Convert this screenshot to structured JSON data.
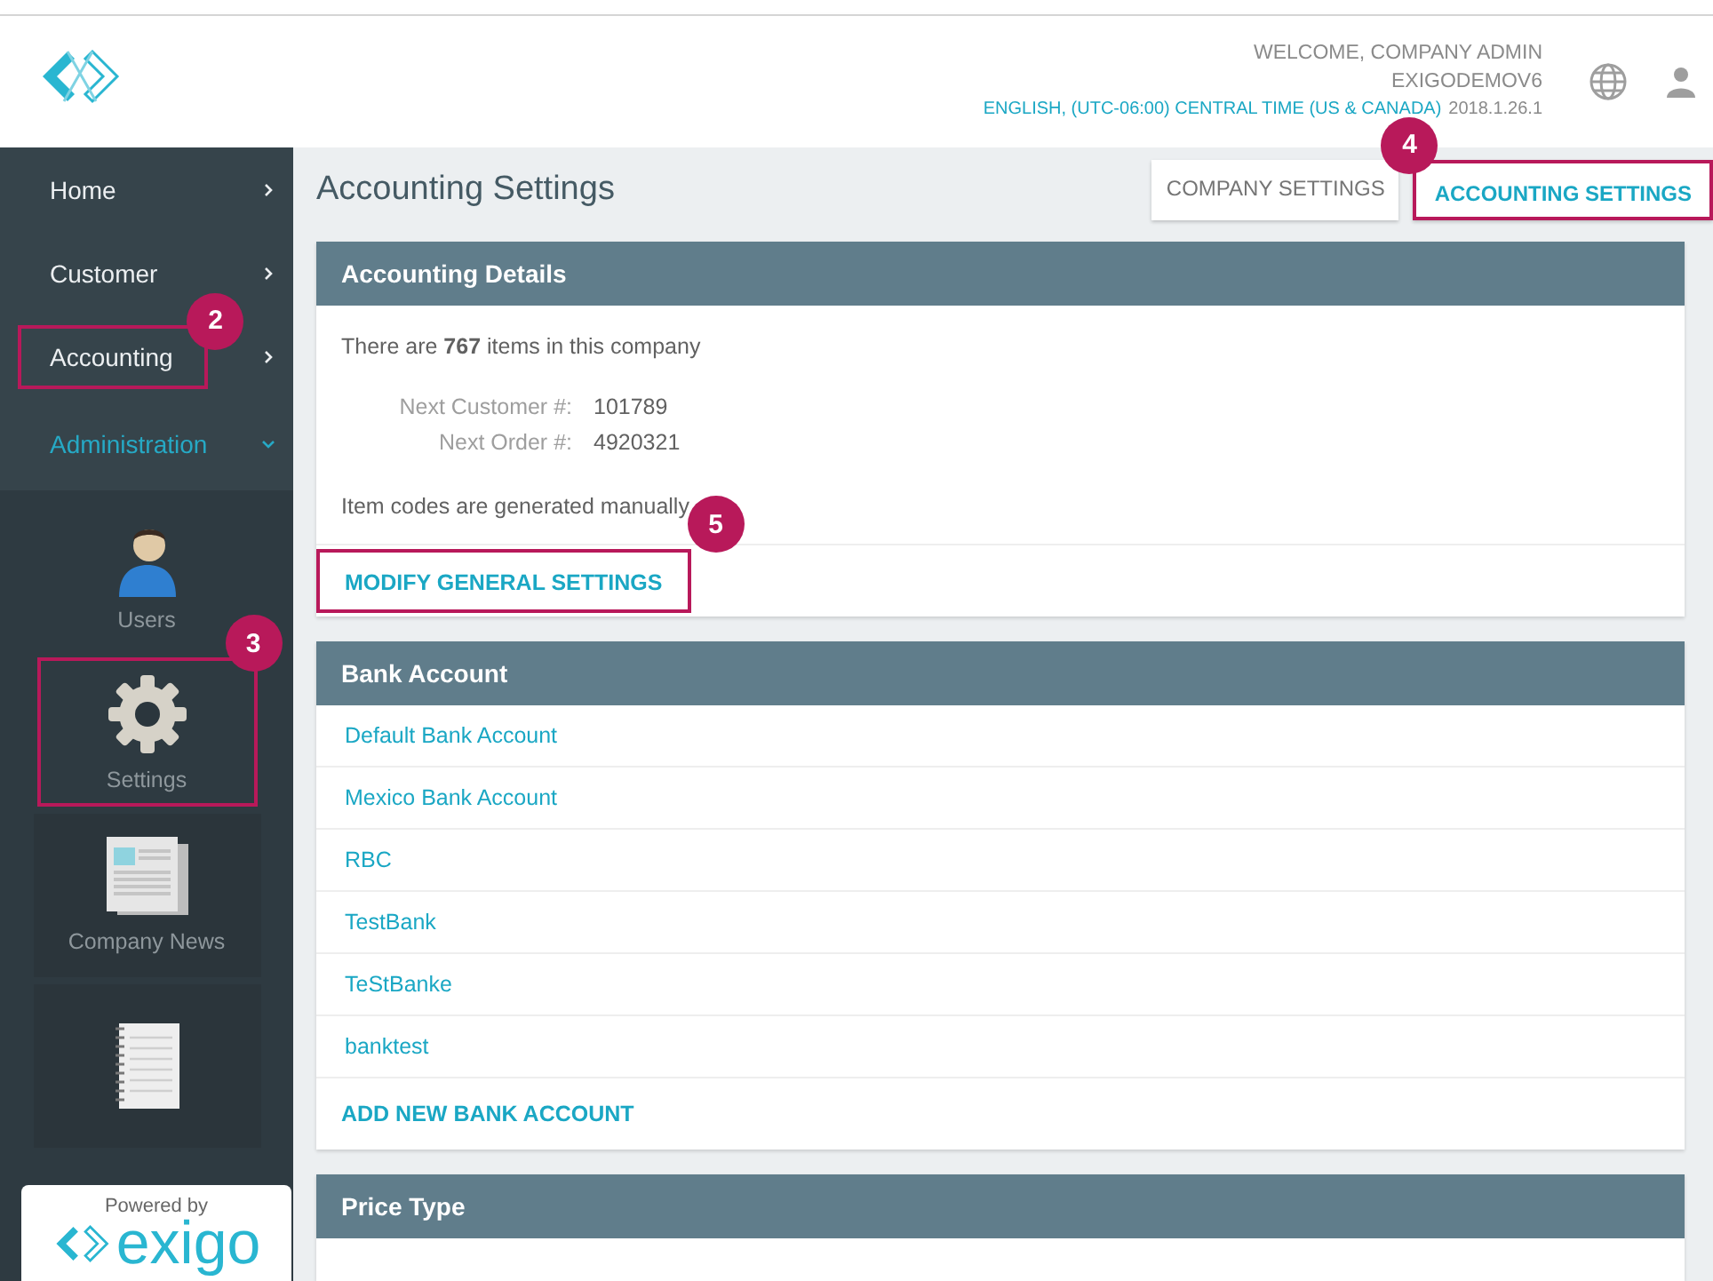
{
  "header": {
    "welcome": "WELCOME, COMPANY ADMIN",
    "company": "EXIGODEMOV6",
    "locale": "ENGLISH, (UTC-06:00) CENTRAL TIME (US & CANADA)",
    "version": "2018.1.26.1"
  },
  "sidebar": {
    "nav": [
      {
        "label": "Home",
        "expanded": false
      },
      {
        "label": "Customer",
        "expanded": false
      },
      {
        "label": "Accounting",
        "expanded": false,
        "callout": "2"
      },
      {
        "label": "Administration",
        "expanded": true
      }
    ],
    "tiles": [
      {
        "kind": "users",
        "label": "Users"
      },
      {
        "kind": "settings",
        "label": "Settings",
        "callout": "3"
      },
      {
        "kind": "news",
        "label": "Company News"
      },
      {
        "kind": "notebook"
      }
    ],
    "powered": {
      "text": "Powered by",
      "brand": "exigo"
    }
  },
  "page_title": "Accounting Settings",
  "tabs": [
    {
      "label": "COMPANY SETTINGS",
      "selected": false
    },
    {
      "label": "ACCOUNTING SETTINGS",
      "selected": true,
      "callout": "4"
    }
  ],
  "details": {
    "title": "Accounting Details",
    "summary": "There are **767** items in this company",
    "fields": [
      {
        "label": "Next Customer #:",
        "value": "101789"
      },
      {
        "label": "Next Order #:",
        "value": "4920321"
      }
    ],
    "note": "Item codes are generated manually",
    "action": {
      "label": "MODIFY GENERAL SETTINGS",
      "callout": "5"
    }
  },
  "bank": {
    "title": "Bank Account",
    "accounts": [
      "Default Bank Account",
      "Mexico Bank Account",
      "RBC",
      "TestBank",
      "TeStBanke",
      "banktest"
    ],
    "action": "ADD NEW BANK ACCOUNT"
  },
  "price": {
    "title": "Price Type"
  }
}
